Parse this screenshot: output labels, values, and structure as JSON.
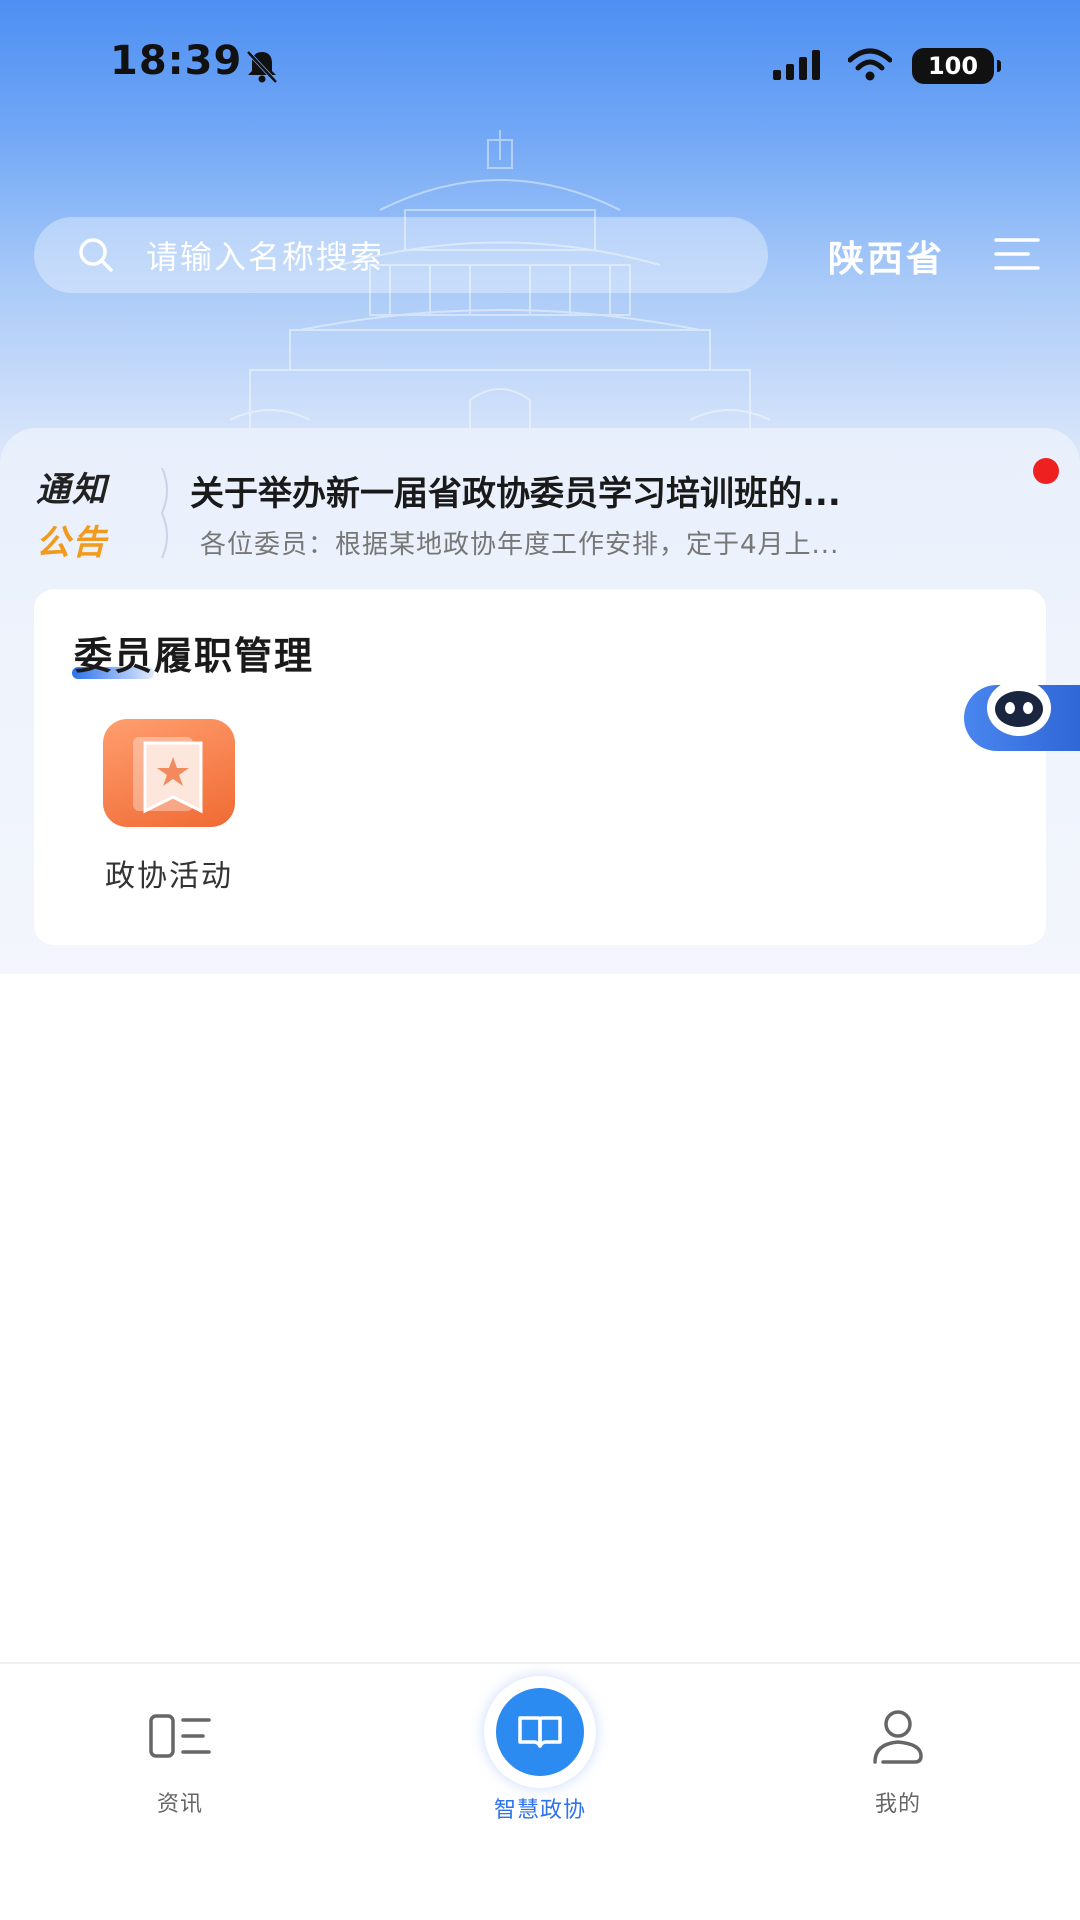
{
  "status_bar": {
    "time": "18:39",
    "battery": "100"
  },
  "header": {
    "search_placeholder": "请输入名称搜索",
    "region": "陕西省"
  },
  "notice": {
    "tag_top": "通知",
    "tag_bottom": "公告",
    "title": "关于举办新一届省政协委员学习培训班的...",
    "summary": "各位委员：根据某地政协年度工作安排，定于4月上..."
  },
  "duty_card": {
    "title": "委员履职管理",
    "items": [
      {
        "label": "政协活动",
        "icon": "bookmark-star-icon"
      }
    ]
  },
  "bottom_nav": {
    "items": [
      {
        "label": "资讯",
        "icon": "news-list-icon"
      },
      {
        "label": "智慧政协",
        "icon": "open-book-icon",
        "active": true
      },
      {
        "label": "我的",
        "icon": "user-icon"
      }
    ]
  },
  "colors": {
    "primary": "#2d72ee",
    "notice_orange": "#f29a1b",
    "badge_red": "#ef2020",
    "activity_orange": "#f06a33"
  }
}
